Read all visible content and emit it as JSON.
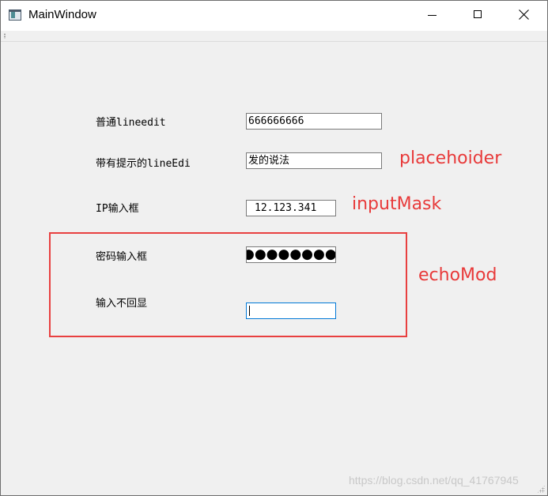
{
  "window": {
    "title": "MainWindow",
    "icon": "app-window-icon",
    "controls": {
      "minimize": "minimize-icon",
      "maximize": "maximize-icon",
      "close": "close-icon"
    }
  },
  "form": {
    "normal": {
      "label": "普通lineedit",
      "value": "666666666"
    },
    "placeholder": {
      "label": "带有提示的lineEdi",
      "placeholder": "发的说法"
    },
    "ip": {
      "label": "IP输入框",
      "value": "12.123.341"
    },
    "password": {
      "label": "密码输入框",
      "masked_display": "●●●●●●●●"
    },
    "noecho": {
      "label": "输入不回显",
      "value": ""
    }
  },
  "annotations": {
    "placeholder": "placehoider",
    "input_mask": "inputMask",
    "echo_mode": "echoMod",
    "color": "#e83a3a"
  },
  "watermark": "https://blog.csdn.net/qq_41767945"
}
